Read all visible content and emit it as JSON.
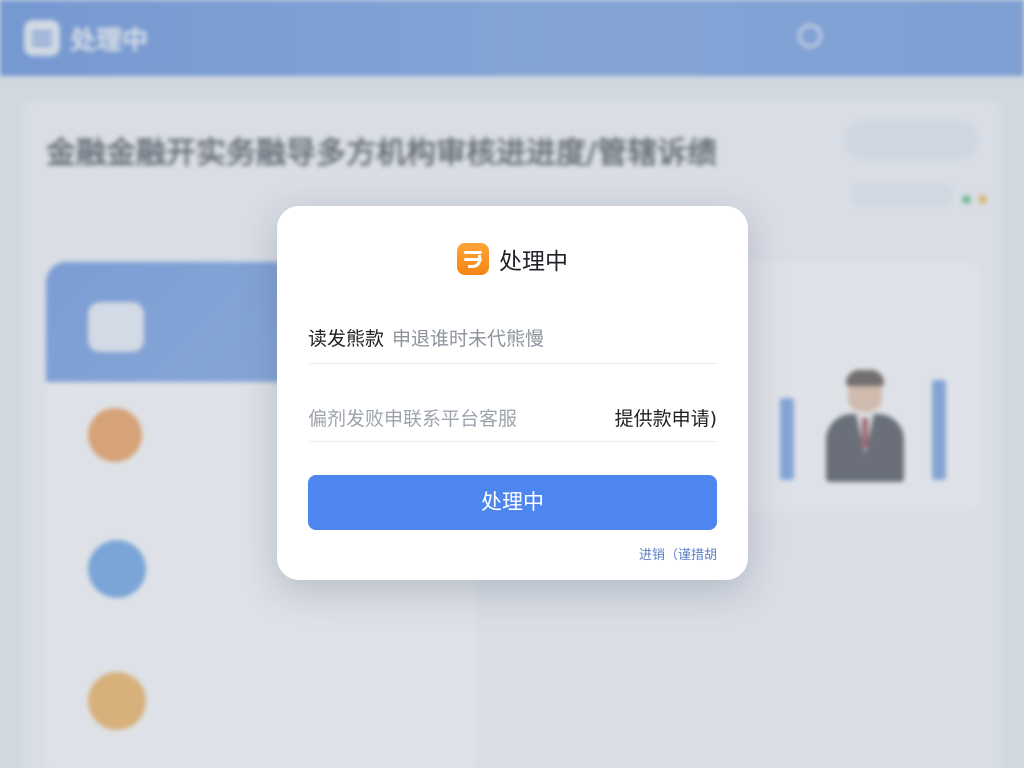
{
  "background": {
    "app_title": "处理中",
    "app_subtitle": "",
    "user_text": "",
    "menu_text": "",
    "page_title": "金融金融开实务融导多方机构审核进进度/管辖诉绩",
    "page_subtitle": "",
    "top_button": "",
    "left_header": "",
    "list_items": [
      {
        "name": "",
        "desc": "",
        "color": "#f08b32"
      },
      {
        "name": "",
        "desc": "",
        "color": "#4a90e2"
      },
      {
        "name": "",
        "desc": "",
        "color": "#f2a53a"
      }
    ],
    "right_panel_title": "",
    "right_panel_more": "",
    "person_caption": "",
    "row_button": ""
  },
  "modal": {
    "title": "处理中",
    "row1_label": "读发熊款",
    "row1_value": "申退谁时未代熊慢",
    "row2_label": "偏剂发败申联系平台客服",
    "row2_action": "提供款申请)",
    "primary_button": "处理中",
    "footer_link": "进销（谨措胡"
  },
  "colors": {
    "accent": "#4c86ee",
    "header_blue": "#3f79d6",
    "modal_icon": "#f58512"
  }
}
